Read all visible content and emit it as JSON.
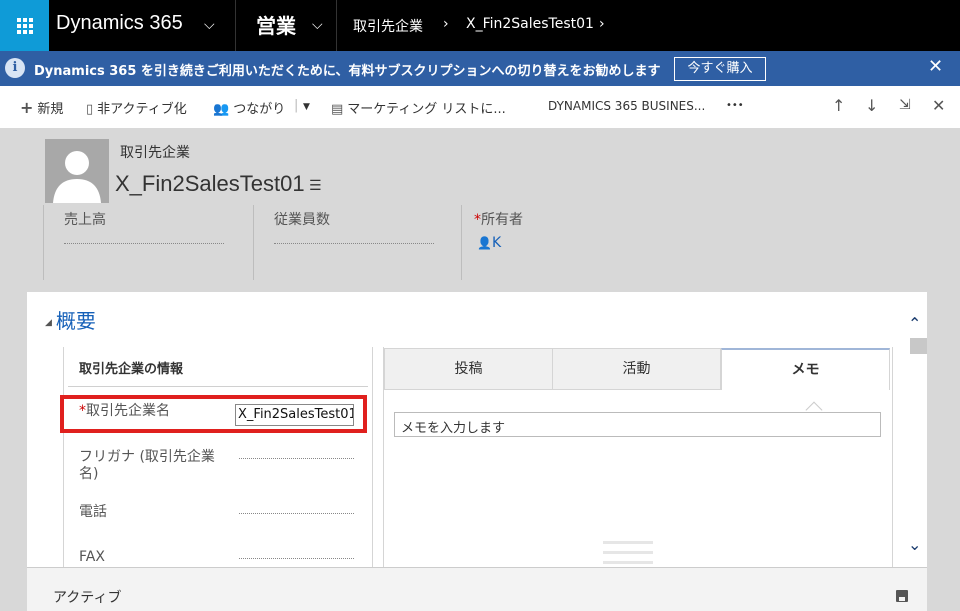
{
  "nav": {
    "app_name": "Dynamics 365",
    "area": "営業",
    "breadcrumb_entity": "取引先企業",
    "breadcrumb_record": "X_Fin2SalesTest01"
  },
  "banner": {
    "info_glyph": "i",
    "text": "Dynamics 365 を引き続きご利用いただくために、有料サブスクリプションへの切り替えをお勧めします",
    "button": "今すぐ購入",
    "close": "✕",
    "color": "#2f5fa4"
  },
  "commands": {
    "new": "新規",
    "deactivate": "非アクティブ化",
    "connect": "つながり",
    "marketing_list": "マーケティング リストに...",
    "d365_business": "DYNAMICS 365 BUSINES...",
    "more": "•••"
  },
  "header": {
    "entity_label": "取引先企業",
    "record_title": "X_Fin2SalesTest01",
    "fields": [
      {
        "label": "売上高",
        "value": ""
      },
      {
        "label": "従業員数",
        "value": ""
      },
      {
        "label": "所有者",
        "required": "*",
        "value": "K"
      }
    ]
  },
  "form": {
    "tab_title": "概要",
    "section_title": "取引先企業の情報",
    "fields": [
      {
        "label": "取引先企業名",
        "required": "*",
        "value": "X_Fin2SalesTest01"
      },
      {
        "label": "フリガナ (取引先企業名)",
        "value": ""
      },
      {
        "label": "電話",
        "value": ""
      },
      {
        "label": "FAX",
        "value": ""
      }
    ]
  },
  "social": {
    "tabs": [
      "投稿",
      "活動",
      "メモ"
    ],
    "active_tab": "メモ",
    "note_placeholder": "メモを入力します"
  },
  "footer": {
    "status": "アクティブ"
  },
  "accent": "#0f9bd7",
  "highlight_color": "#e0201e"
}
